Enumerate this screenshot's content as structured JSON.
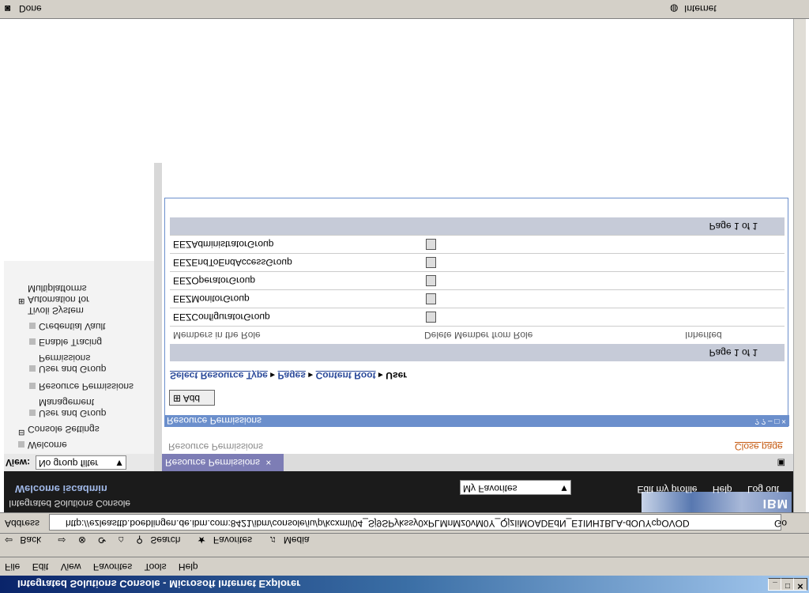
{
  "window": {
    "title": "Integrated Solutions Console - Microsoft Internet Explorer"
  },
  "menu": {
    "items": [
      "File",
      "Edit",
      "View",
      "Favorites",
      "Tools",
      "Help"
    ]
  },
  "toolbar": {
    "back": "Back",
    "search": "Search",
    "favorites": "Favorites",
    "media": "Media"
  },
  "address": {
    "label": "Address",
    "url": "http://ezleasttb.boeblingen.de.ibm.com:8421/ibm/console/iu/p/kcxml/04_Sj9SPykssy0xPLMnMz0vM0Y_QjzIiMOADEdN_E1INH1BLA-dOUYcpOVOD",
    "go": "Go"
  },
  "header": {
    "welcome": "Welcome iscadmin",
    "product": "Integrated Solutions Console",
    "favorites_select": "My Favorites",
    "links": [
      "Edit my profile",
      "Help",
      "Log out"
    ],
    "logo": "IBM"
  },
  "nav": {
    "view_label": "View:",
    "view_value": "No group filter",
    "items": [
      "Welcome",
      "Console Settings",
      "User and Group Management",
      "Resource Permissions",
      "User and Group Permissions",
      "Enable Tracing",
      "Credential Vault",
      "Tivoli System Automation for Multiplatforms"
    ]
  },
  "content": {
    "tab_label": "Resource Permissions",
    "breadcrumb": "Resource Permissions",
    "close_page": "Close page",
    "portlet_title": "Resource Permissions",
    "add_button": "Add",
    "resource_trail": [
      "Select Resource Type",
      "Pages",
      "Content Root",
      "User"
    ],
    "page_info": "Page 1 of 1",
    "columns": [
      "Members in the Role",
      "Delete Member from Role",
      "Inherited"
    ],
    "rows": [
      "EEZConfiguratorGroup",
      "EEZMonitorGroup",
      "EEZOperatorGroup",
      "EEZEndToEndAccessGroup",
      "EEZAdministratorGroup"
    ]
  },
  "status": {
    "text": "Done",
    "zone": "Internet"
  }
}
